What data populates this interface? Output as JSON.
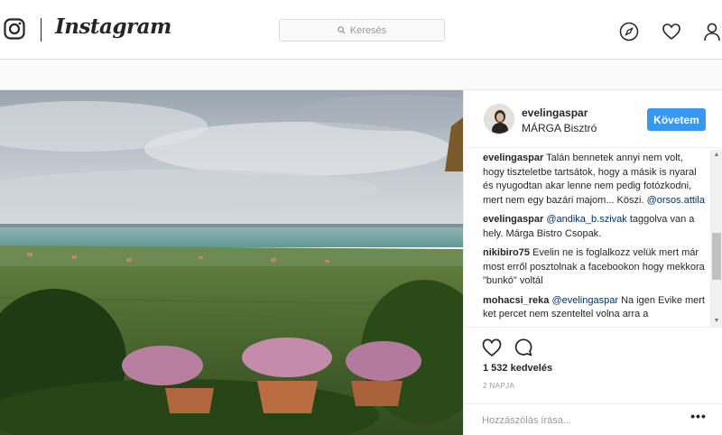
{
  "app": {
    "name": "Instagram"
  },
  "header": {
    "search_placeholder": "Keresés",
    "icons": [
      "instagram-glyph-icon",
      "search-icon",
      "compass-icon",
      "heart-icon",
      "user-icon"
    ]
  },
  "post": {
    "username": "evelingaspar",
    "location": "MÁRGA Bisztró",
    "follow_label": "Követem",
    "comments": [
      {
        "user": "evelingaspar",
        "text": "Talán bennetek annyi nem volt, hogy tiszteletbe tartsátok, hogy a másik is nyaral és nyugodtan akar lenne nem pedig fotózkodni, mert nem egy bazári majom... Köszi.",
        "mention": "@orsos.attila",
        "after": ""
      },
      {
        "user": "evelingaspar",
        "text": "",
        "mention": "@andika_b.szivak",
        "after": "taggolva van a hely. Márga Bistro Csopak."
      },
      {
        "user": "nikibiro75",
        "text": "Evelin ne is foglalkozz velük mert már most erről posztolnak a facebookon hogy mekkora \"bunkó\" voltál",
        "mention": "",
        "after": ""
      },
      {
        "user": "mohacsi_reka",
        "text": "",
        "mention": "@evelingaspar",
        "after": "Na igen Evike mert ket percet nem szenteltel volna arra a"
      }
    ],
    "likes": "1 532 kedvelés",
    "time": "2 NAPJA",
    "add_comment_placeholder": "Hozzászólás írása...",
    "more_label": "•••"
  },
  "colors": {
    "accent": "#3897f0",
    "border": "#dbdbdb",
    "mention": "#003569"
  }
}
